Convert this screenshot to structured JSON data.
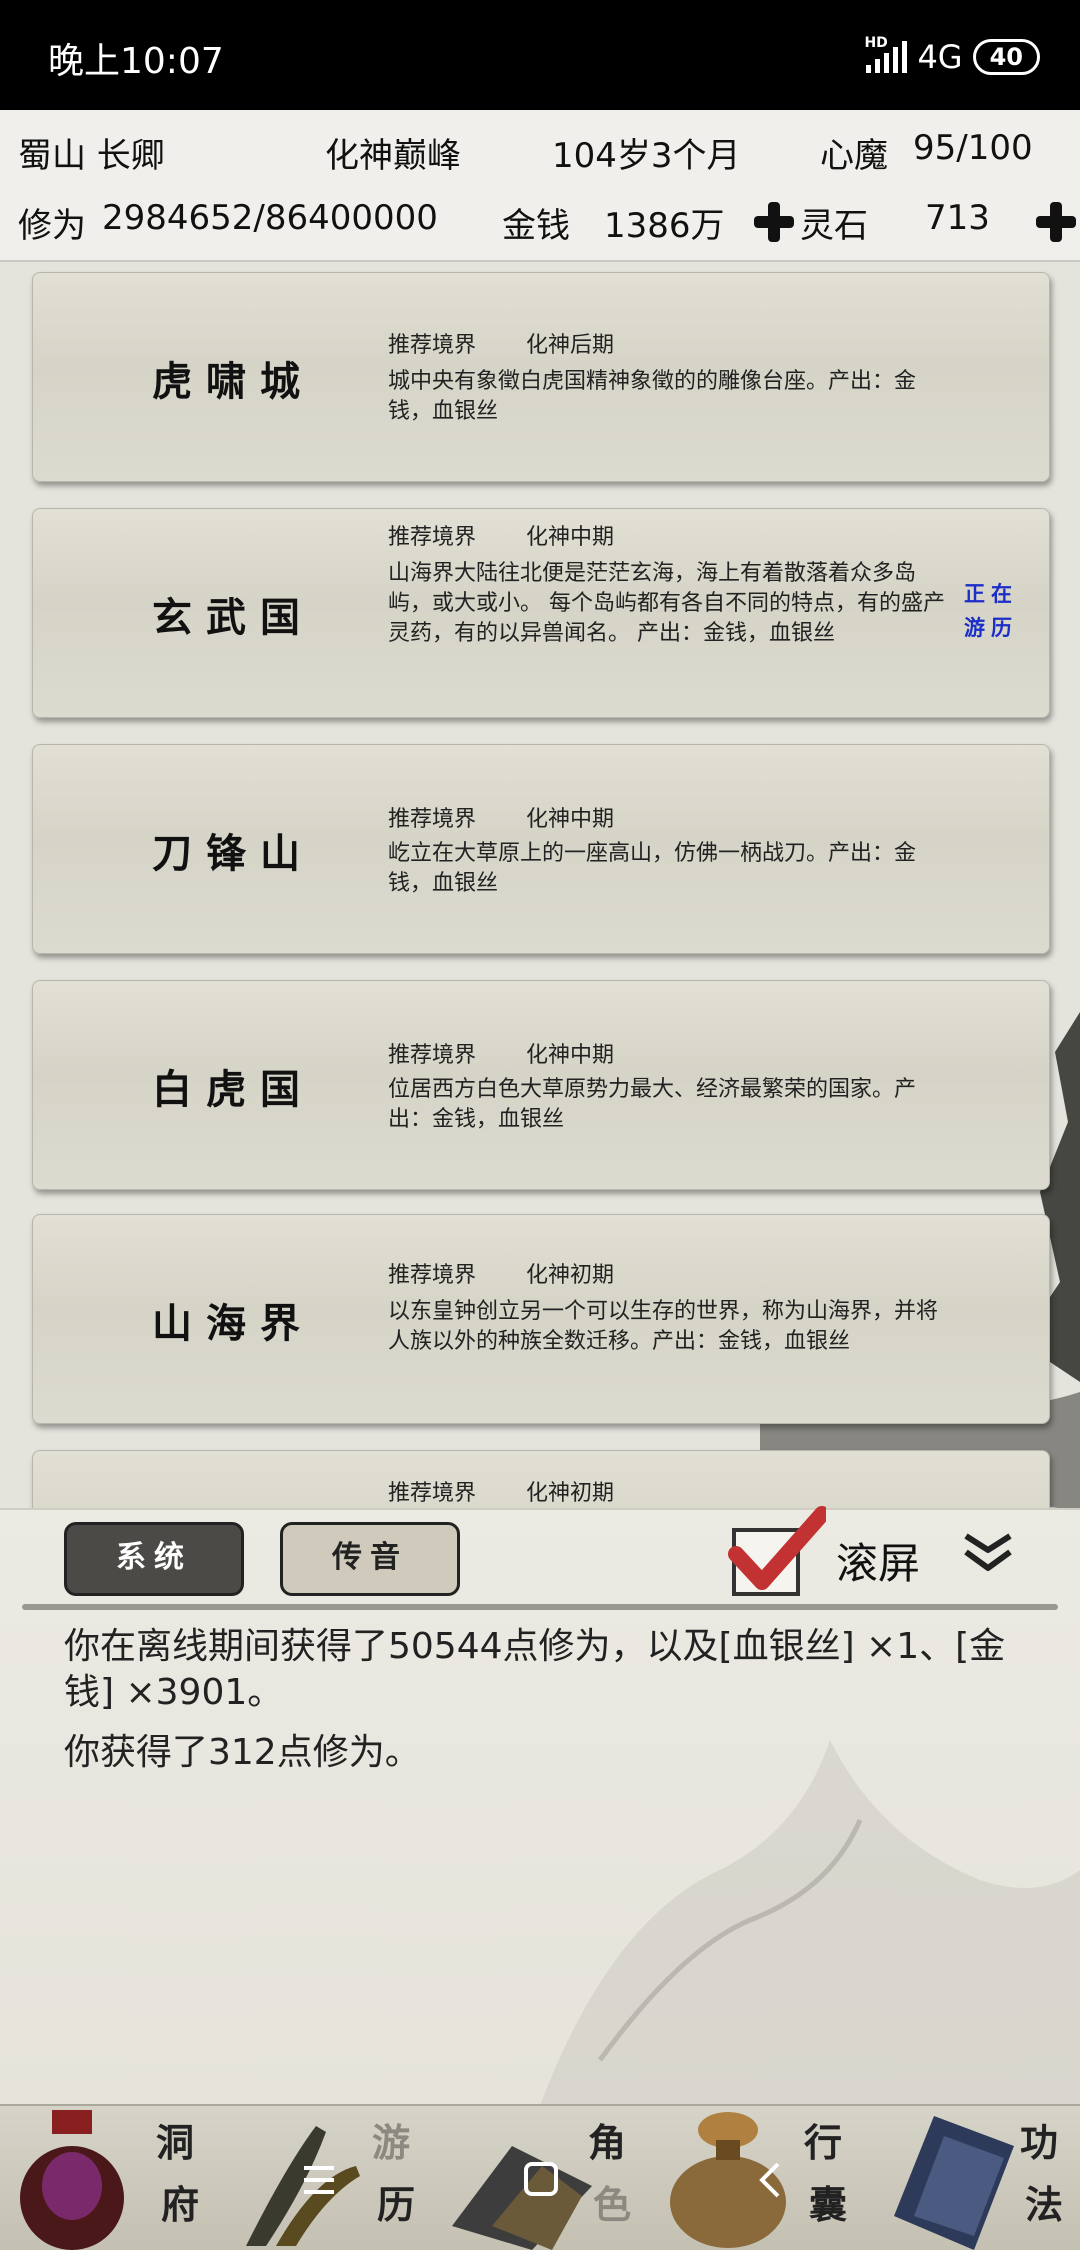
{
  "status_bar": {
    "time": "晚上10:07",
    "hd": "HD",
    "network": "4G",
    "battery": "40"
  },
  "header": {
    "sect": "蜀山 长卿",
    "realm": "化神巅峰",
    "age": "104岁3个月",
    "heart_demon_label": "心魔",
    "heart_demon_value": "95/100",
    "cultivation_label": "修为",
    "cultivation_value": "2984652/86400000",
    "money_label": "金钱",
    "money_value": "1386万",
    "spirit_stone_label": "灵石",
    "spirit_stone_value": "713"
  },
  "locations": [
    {
      "name": "虎啸城",
      "rec_label": "推荐境界",
      "rec_value": "化神后期",
      "desc": "城中央有象徵白虎国精神象徵的的雕像台座。产出：金钱，血银丝"
    },
    {
      "name": "玄武国",
      "rec_label": "推荐境界",
      "rec_value": "化神中期",
      "desc": "山海界大陆往北便是茫茫玄海，海上有着散落着众多岛屿，或大或小。 每个岛屿都有各自不同的特点，有的盛产灵药，有的以异兽闻名。 产出：金钱，血银丝",
      "tag_line1": "正在",
      "tag_line2": "游历"
    },
    {
      "name": "刀锋山",
      "rec_label": "推荐境界",
      "rec_value": "化神中期",
      "desc": "屹立在大草原上的一座高山，仿佛一柄战刀。产出：金钱，血银丝"
    },
    {
      "name": "白虎国",
      "rec_label": "推荐境界",
      "rec_value": "化神中期",
      "desc": "位居西方白色大草原势力最大、经济最繁荣的国家。产出：金钱，血银丝"
    },
    {
      "name": "山海界",
      "rec_label": "推荐境界",
      "rec_value": "化神初期",
      "desc": "以东皇钟创立另一个可以生存的世界，称为山海界，并将人族以外的种族全数迁移。产出：金钱，血银丝"
    },
    {
      "name": "",
      "rec_label": "推荐境界",
      "rec_value": "化神初期",
      "desc": ""
    }
  ],
  "panel": {
    "tab_system": "系统",
    "tab_voice": "传音",
    "scroll_label": "滚屏",
    "scroll_checked": true,
    "messages": [
      "你在离线期间获得了50544点修为，以及[血银丝] ×1、[金钱] ×3901。",
      "你获得了312点修为。"
    ]
  },
  "nav": {
    "items": [
      {
        "line1": "洞",
        "line2": "府",
        "icon": "general-sack-icon"
      },
      {
        "line1": "游",
        "line2": "历",
        "icon": "brush-icon"
      },
      {
        "line1": "角",
        "line2": "色",
        "icon": "hat-icon"
      },
      {
        "line1": "行",
        "line2": "囊",
        "icon": "bag-icon"
      },
      {
        "line1": "功",
        "line2": "法",
        "icon": "book-icon"
      }
    ]
  },
  "colors": {
    "active_tag": "#1c2ec8",
    "card_bg": "#d9d7cb",
    "status_bg": "#000000"
  }
}
